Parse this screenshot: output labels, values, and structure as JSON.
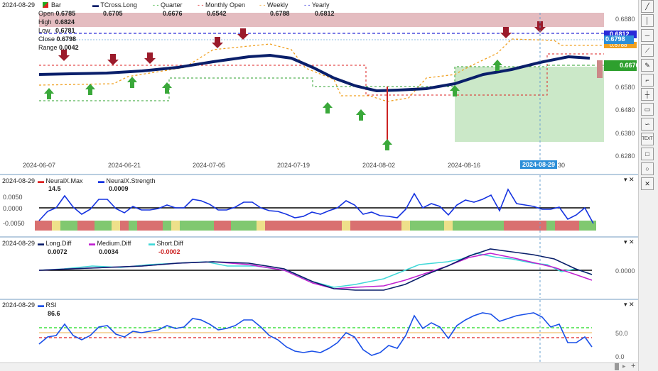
{
  "main": {
    "date": "2024-08-29",
    "legend": [
      {
        "name": "Bar",
        "value": ""
      },
      {
        "name": "TCross.Long",
        "value": "0.6705"
      },
      {
        "name": "Quarter",
        "value": "0.6676"
      },
      {
        "name": "Monthly Open",
        "value": "0.6542"
      },
      {
        "name": "Weekly",
        "value": "0.6788"
      },
      {
        "name": "Yearly",
        "value": "0.6812"
      }
    ],
    "ohlc": [
      {
        "k": "Open",
        "v": "0.6785"
      },
      {
        "k": "High",
        "v": "0.6824"
      },
      {
        "k": "Low",
        "v": "0.6781"
      },
      {
        "k": "Close",
        "v": "0.6798"
      },
      {
        "k": "Range",
        "v": "0.0042"
      }
    ],
    "y_ticks": [
      "0.6880",
      "0.6580",
      "0.6480",
      "0.6380",
      "0.6280"
    ],
    "price_tags": {
      "yearly": "0.6812",
      "close": "0.6798",
      "weekly": "0.6788",
      "quarter": "0.6676"
    },
    "x_ticks": [
      "2024-06-07",
      "2024-06-21",
      "2024-07-05",
      "2024-07-19",
      "2024-08-02",
      "2024-08-16"
    ],
    "cursor_date": "2024-08-29",
    "cursor_after": "30",
    "colors": {
      "yearly": "#2a2ad8",
      "close": "#2d8fd8",
      "weekly": "#f0a020",
      "quarter": "#2ea02e"
    }
  },
  "neural": {
    "date": "2024-08-29",
    "max_label": "NeuralX.Max",
    "max_value": "14.5",
    "strength_label": "NeuralX.Strength",
    "strength_value": "0.0009",
    "y_ticks": [
      "0.0050",
      "0.0000",
      "-0.0050"
    ]
  },
  "diff": {
    "date": "2024-08-29",
    "long_label": "Long.Diff",
    "long_value": "0.0072",
    "medium_label": "Medium.Diff",
    "medium_value": "0.0034",
    "short_label": "Short.Diff",
    "short_value": "-0.0002",
    "y_tick": "0.0000"
  },
  "rsi": {
    "date": "2024-08-29",
    "label": "RSI",
    "value": "86.6",
    "y_ticks": [
      "50.0",
      "0.0"
    ]
  },
  "toolbar": [
    "line",
    "vertical-line",
    "horizontal-line",
    "ray",
    "pen",
    "step",
    "crosshair",
    "callout",
    "curve",
    "TEXT",
    "rectangle",
    "ellipse",
    "close"
  ]
}
